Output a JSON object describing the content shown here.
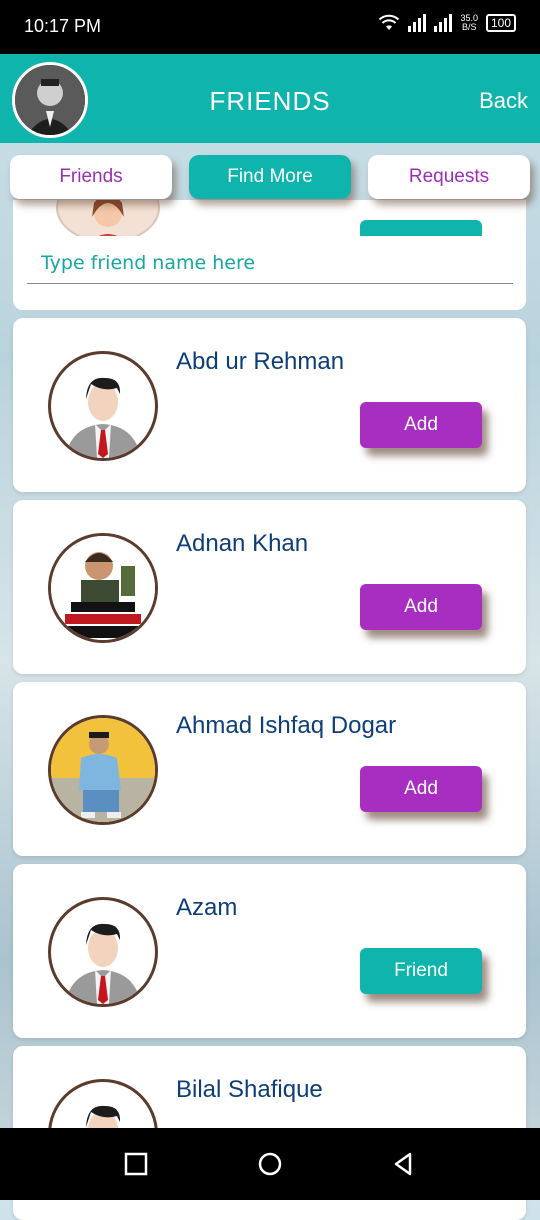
{
  "status_bar": {
    "time": "10:17 PM",
    "net_speed_value": "35.0",
    "net_speed_unit": "B/S",
    "battery": "100"
  },
  "header": {
    "title": "FRIENDS",
    "back_label": "Back"
  },
  "tabs": [
    {
      "label": "Friends"
    },
    {
      "label": "Find More"
    },
    {
      "label": "Requests"
    }
  ],
  "search": {
    "placeholder": "Type friend name here",
    "value": ""
  },
  "users": [
    {
      "name": "Abd ur Rehman",
      "action": "Add",
      "avatar": "default-avatar"
    },
    {
      "name": "Adnan Khan",
      "action": "Add",
      "avatar": "photo-avatar"
    },
    {
      "name": "Ahmad Ishfaq Dogar",
      "action": "Add",
      "avatar": "photo-avatar"
    },
    {
      "name": "Azam",
      "action": "Friend",
      "avatar": "default-avatar"
    },
    {
      "name": "Bilal Shafique",
      "action": "",
      "avatar": "default-avatar"
    }
  ],
  "colors": {
    "teal": "#0fb5ac",
    "purple": "#a72ec0",
    "name_blue": "#0e3e78"
  }
}
